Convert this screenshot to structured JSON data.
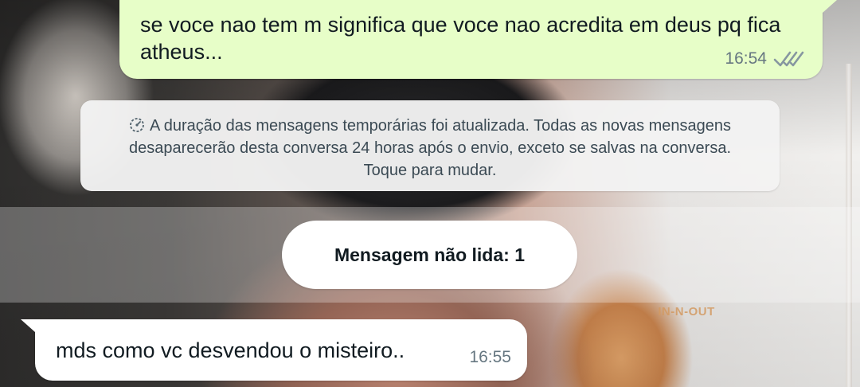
{
  "chat": {
    "outgoing_message": {
      "text": "se voce nao tem m significa que voce nao acredita em deus pq fica atheus...",
      "time": "16:54",
      "status_icon": "double-check-icon"
    },
    "system_notice": {
      "icon": "timer-icon",
      "text": "A duração das mensagens temporárias foi atualizada. Todas as novas mensagens desaparecerão desta conversa 24 horas após o envio, exceto se salvas na conversa. Toque para mudar."
    },
    "unread_divider": {
      "label": "Mensagem não lida: 1"
    },
    "incoming_message": {
      "text": "mds como vc desvendou o misteiro..",
      "time": "16:55"
    }
  },
  "wallpaper": {
    "sign_text": "IN-N-OUT"
  },
  "colors": {
    "outgoing_bubble": "#e7fec8",
    "incoming_bubble": "#ffffff",
    "system_notice_bg": "#f3f3f3",
    "timestamp": "#667781",
    "read_ticks": "#8696a0"
  }
}
